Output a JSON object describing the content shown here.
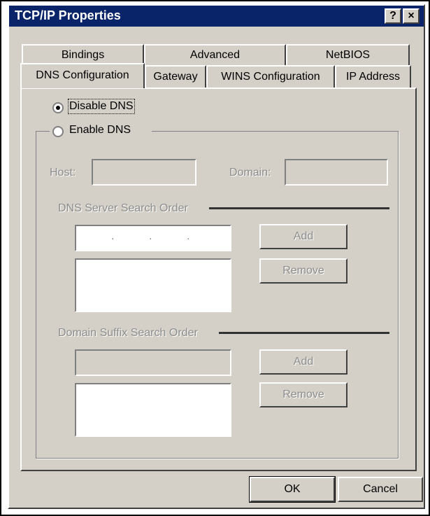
{
  "window": {
    "title": "TCP/IP Properties",
    "help_button": "?",
    "close_button": "×"
  },
  "tabs": {
    "row1": [
      "Bindings",
      "Advanced",
      "NetBIOS"
    ],
    "row2": [
      "DNS Configuration",
      "Gateway",
      "WINS Configuration",
      "IP Address"
    ],
    "active": "DNS Configuration"
  },
  "dns": {
    "disable_label": "Disable DNS",
    "enable_label": "Enable DNS",
    "selected": "Disable DNS",
    "host_label": "Host:",
    "domain_label": "Domain:",
    "host_value": "",
    "domain_value": ""
  },
  "server_order": {
    "label": "DNS Server Search Order",
    "ip_dots": [
      ".",
      ".",
      "."
    ],
    "add_label": "Add",
    "remove_label": "Remove"
  },
  "suffix_order": {
    "label": "Domain Suffix Search Order",
    "add_label": "Add",
    "remove_label": "Remove"
  },
  "footer": {
    "ok_label": "OK",
    "cancel_label": "Cancel"
  }
}
